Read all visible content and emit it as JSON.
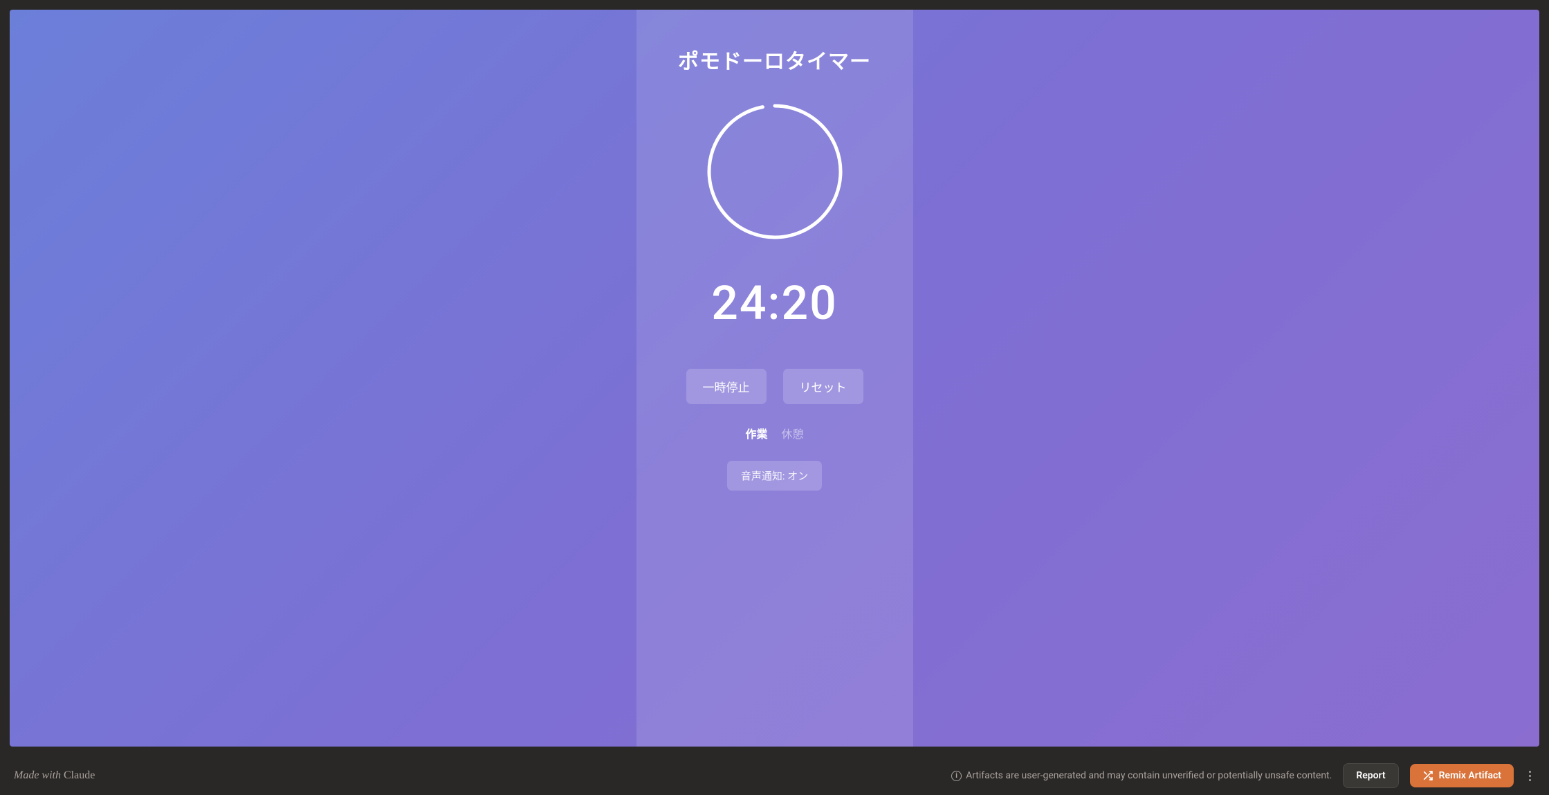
{
  "timer": {
    "title": "ポモドーロタイマー",
    "time_display": "24:20",
    "progress_percent": 97,
    "buttons": {
      "pause": "一時停止",
      "reset": "リセット"
    },
    "modes": {
      "work": "作業",
      "break": "休憩",
      "active": "work"
    },
    "sound_toggle": "音声通知: オン"
  },
  "footer": {
    "made_with_prefix": "Made with ",
    "made_with_brand": "Claude",
    "warning": "Artifacts are user-generated and may contain unverified or potentially unsafe content.",
    "report": "Report",
    "remix": "Remix Artifact"
  }
}
